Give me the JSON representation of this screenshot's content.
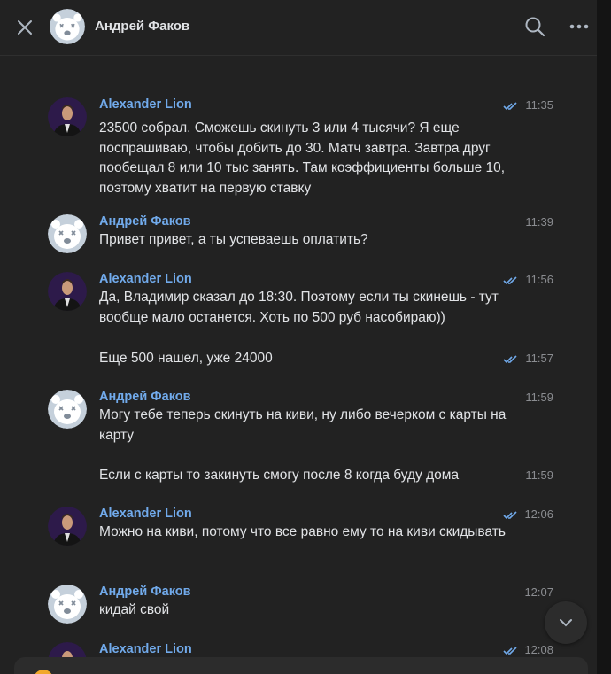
{
  "header": {
    "title": "Андрей Факов",
    "close_icon": "close-icon",
    "search_icon": "search-icon",
    "more_icon": "more-icon"
  },
  "colors": {
    "author": "#71aaeb",
    "text": "#e1e3e6",
    "time": "#8b8d91",
    "check": "#71aaeb",
    "panel": "#222222"
  },
  "messages": [
    {
      "author": "Alexander Lion",
      "time": "11:35",
      "read": true,
      "text": "23500 собрал. Сможешь скинуть 3 или 4 тысячи? Я еще поспрашиваю, чтобы добить до 30. Матч завтра. Завтра друг пообещал 8 или 10 тыс занять. Там коэффициенты больше 10, поэтому хватит на первую ставку"
    },
    {
      "author": "Андрей Факов",
      "time": "11:39",
      "read": false,
      "text": "Привет привет, а ты успеваешь оплатить?"
    },
    {
      "author": "Alexander Lion",
      "time": "11:56",
      "read": true,
      "text": "Да, Владимир сказал до 18:30. Поэтому если ты скинешь - тут вообще мало останется. Хоть по 500 руб насобираю))"
    },
    {
      "author": "",
      "time": "11:57",
      "read": true,
      "text": "Еще 500 нашел, уже 24000"
    },
    {
      "author": "Андрей Факов",
      "time": "11:59",
      "read": false,
      "text": "Могу тебе теперь скинуть на киви, ну либо вечерком с карты на карту"
    },
    {
      "author": "",
      "time": "11:59",
      "read": false,
      "text": "Если с карты то закинуть смогу после 8 когда буду дома"
    },
    {
      "author": "Alexander Lion",
      "time": "12:06",
      "read": true,
      "text": "Можно на киви, потому что все равно ему то на киви скидывать"
    },
    {
      "author": "Андрей Факов",
      "time": "12:07",
      "read": false,
      "text": "кидай свой"
    },
    {
      "author": "Alexander Lion",
      "time": "12:08",
      "read": true,
      "text": ""
    }
  ],
  "scroll_down_icon": "chevron-down-icon"
}
